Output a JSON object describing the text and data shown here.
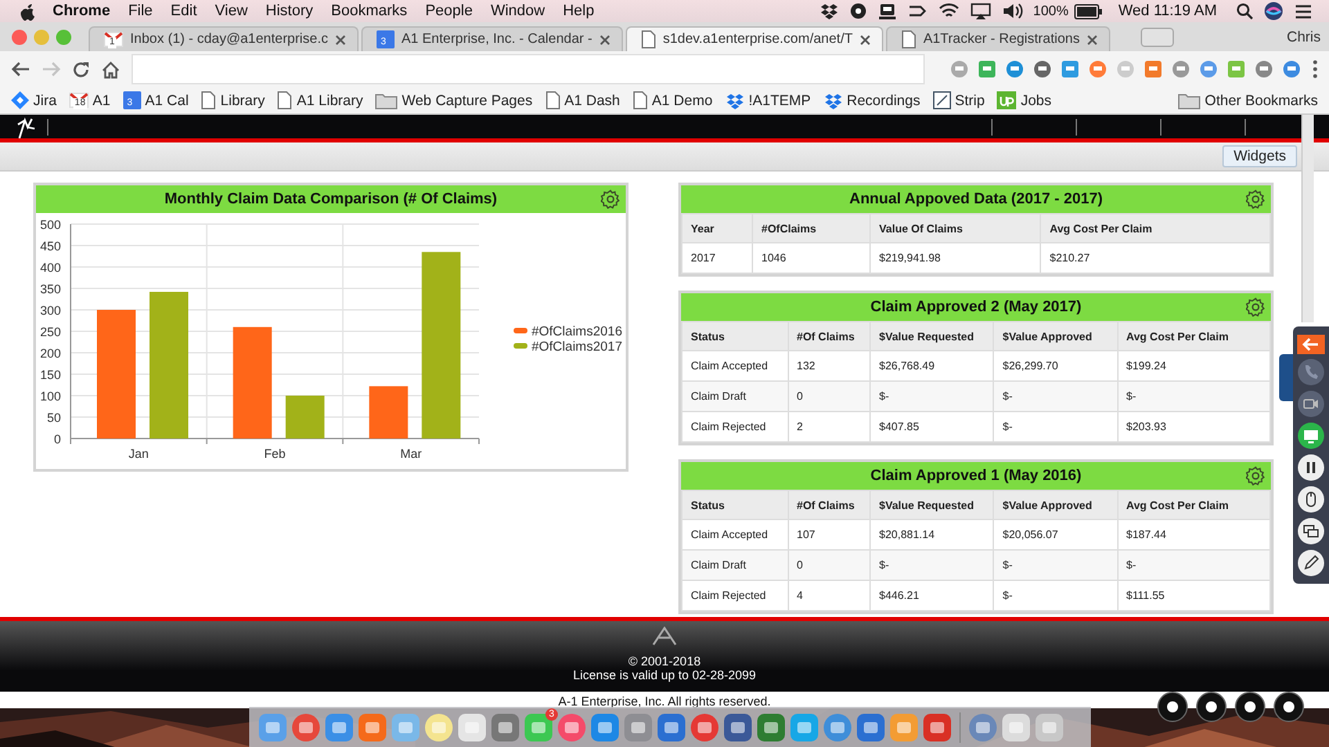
{
  "menubar": {
    "app": "Chrome",
    "menus": [
      "File",
      "Edit",
      "View",
      "History",
      "Bookmarks",
      "People",
      "Window",
      "Help"
    ],
    "battery": "100%",
    "clock": "Wed 11:19 AM"
  },
  "tabs": [
    {
      "title": "Inbox (1) - cday@a1enterprise.c",
      "kind": "gmail",
      "badge": "1",
      "selected": false
    },
    {
      "title": "A1 Enterprise, Inc. - Calendar -",
      "kind": "calendar",
      "badge": "3",
      "selected": false
    },
    {
      "title": "s1dev.a1enterprise.com/anet/T",
      "kind": "page",
      "selected": true
    },
    {
      "title": "A1Tracker - Registrations",
      "kind": "page",
      "selected": false
    }
  ],
  "profile": "Chris",
  "bookmarks": [
    {
      "label": "Jira",
      "kind": "jira"
    },
    {
      "label": "A1",
      "kind": "gmail",
      "badge": "18"
    },
    {
      "label": "A1 Cal",
      "kind": "calendar",
      "badge": "3"
    },
    {
      "label": "Library",
      "kind": "page"
    },
    {
      "label": "A1 Library",
      "kind": "page"
    },
    {
      "label": "Web Capture Pages",
      "kind": "folder"
    },
    {
      "label": "A1 Dash",
      "kind": "page"
    },
    {
      "label": "A1 Demo",
      "kind": "page"
    },
    {
      "label": "!A1TEMP",
      "kind": "dropbox"
    },
    {
      "label": "Recordings",
      "kind": "dropbox"
    },
    {
      "label": "Strip",
      "kind": "strip"
    },
    {
      "label": "Jobs",
      "kind": "upwork"
    }
  ],
  "other_bookmarks": "Other Bookmarks",
  "widgets_button": "Widgets",
  "chart_panel": {
    "title": "Monthly Claim Data Comparison (# Of Claims)",
    "chart_data": {
      "type": "bar",
      "categories": [
        "Jan",
        "Feb",
        "Mar"
      ],
      "series": [
        {
          "name": "#OfClaims2016",
          "color": "#ff6619",
          "values": [
            300,
            260,
            122
          ]
        },
        {
          "name": "#OfClaims2017",
          "color": "#a2b219",
          "values": [
            342,
            100,
            435
          ]
        }
      ],
      "grid": true,
      "legend": true,
      "ylim": [
        0,
        500
      ],
      "yticks": [
        0,
        50,
        100,
        150,
        200,
        250,
        300,
        350,
        400,
        450,
        500
      ]
    }
  },
  "tables": [
    {
      "title": "Annual Appoved Data (2017 - 2017)",
      "columns": [
        "Year",
        "#OfClaims",
        "Value Of Claims",
        "Avg Cost Per Claim"
      ],
      "rows": [
        [
          "2017",
          "1046",
          "$219,941.98",
          "$210.27"
        ]
      ]
    },
    {
      "title": "Claim Approved 2 (May 2017)",
      "columns": [
        "Status",
        "#Of Claims",
        "$Value Requested",
        "$Value Approved",
        "Avg Cost Per Claim"
      ],
      "rows": [
        [
          "Claim Accepted",
          "132",
          "$26,768.49",
          "$26,299.70",
          "$199.24"
        ],
        [
          "Claim Draft",
          "0",
          "$-",
          "$-",
          "$-"
        ],
        [
          "Claim Rejected",
          "2",
          "$407.85",
          "$-",
          "$203.93"
        ]
      ]
    },
    {
      "title": "Claim Approved 1 (May 2016)",
      "columns": [
        "Status",
        "#Of Claims",
        "$Value Requested",
        "$Value Approved",
        "Avg Cost Per Claim"
      ],
      "rows": [
        [
          "Claim Accepted",
          "107",
          "$20,881.14",
          "$20,056.07",
          "$187.44"
        ],
        [
          "Claim Draft",
          "0",
          "$-",
          "$-",
          "$-"
        ],
        [
          "Claim Rejected",
          "4",
          "$446.21",
          "$-",
          "$111.55"
        ]
      ]
    }
  ],
  "footer": {
    "copyright": "© 2001-2018",
    "license": "License is valid up to 02-28-2099",
    "rights": "A-1 Enterprise, Inc. All rights reserved."
  },
  "dock": {
    "badge": "3"
  }
}
